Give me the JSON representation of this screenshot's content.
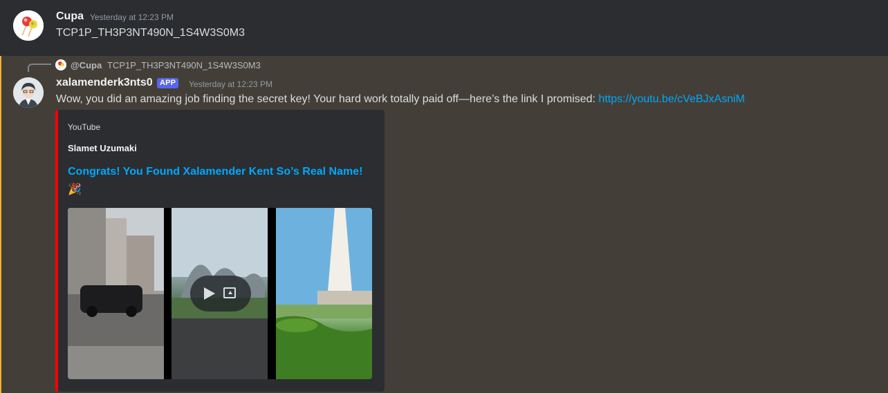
{
  "colors": {
    "mention_bar": "#f0b232",
    "mention_bg": "#433f38",
    "link": "#00a8fc",
    "app_badge": "#5865f2",
    "embed_border": "#ff0000"
  },
  "message1": {
    "username": "Cupa",
    "timestamp": "Yesterday at 12:23 PM",
    "content": "TCP1P_TH3P3NT490N_1S4W3S0M3"
  },
  "message2": {
    "reply": {
      "username": "@Cupa",
      "text": "TCP1P_TH3P3NT490N_1S4W3S0M3"
    },
    "username": "xalamenderk3nts0",
    "badge": "APP",
    "timestamp": "Yesterday at 12:23 PM",
    "content_text": "Wow, you did an amazing job finding the secret key! Your hard work totally paid off—here’s the link I promised: ",
    "link": "https://youtu.be/cVeBJxAsniM",
    "embed": {
      "provider": "YouTube",
      "author": "Slamet Uzumaki",
      "title": "Congrats! You Found Xalamender Kent So’s Real Name! 🎉",
      "thumbnail_icon": "play-icon"
    }
  }
}
